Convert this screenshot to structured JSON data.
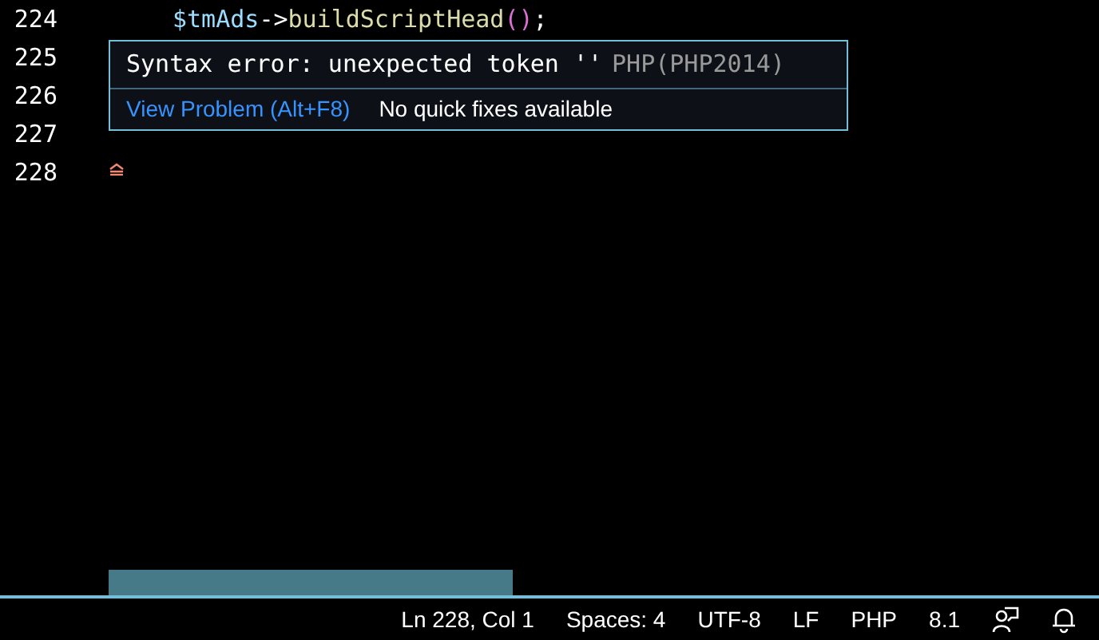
{
  "editor": {
    "lines": [
      {
        "number": "224",
        "tokens": [
          {
            "kind": "variable",
            "text": "$tmAds"
          },
          {
            "kind": "operator",
            "text": "->"
          },
          {
            "kind": "function",
            "text": "buildScriptHead"
          },
          {
            "kind": "bracket",
            "text": "()"
          },
          {
            "kind": "operator",
            "text": ";"
          }
        ]
      },
      {
        "number": "225"
      },
      {
        "number": "226"
      },
      {
        "number": "227"
      },
      {
        "number": "228"
      }
    ]
  },
  "hover": {
    "message": "Syntax error: unexpected token ''",
    "source": "PHP(PHP2014)",
    "action": "View Problem (Alt+F8)",
    "note": "No quick fixes available"
  },
  "status_bar": {
    "items": [
      {
        "kind": "text",
        "text": "Ln 228, Col 1"
      },
      {
        "kind": "text",
        "text": "Spaces: 4"
      },
      {
        "kind": "text",
        "text": "UTF-8"
      },
      {
        "kind": "text",
        "text": "LF"
      },
      {
        "kind": "text",
        "text": "PHP"
      },
      {
        "kind": "text",
        "text": "8.1"
      },
      {
        "kind": "feedback"
      },
      {
        "kind": "bell"
      }
    ]
  }
}
